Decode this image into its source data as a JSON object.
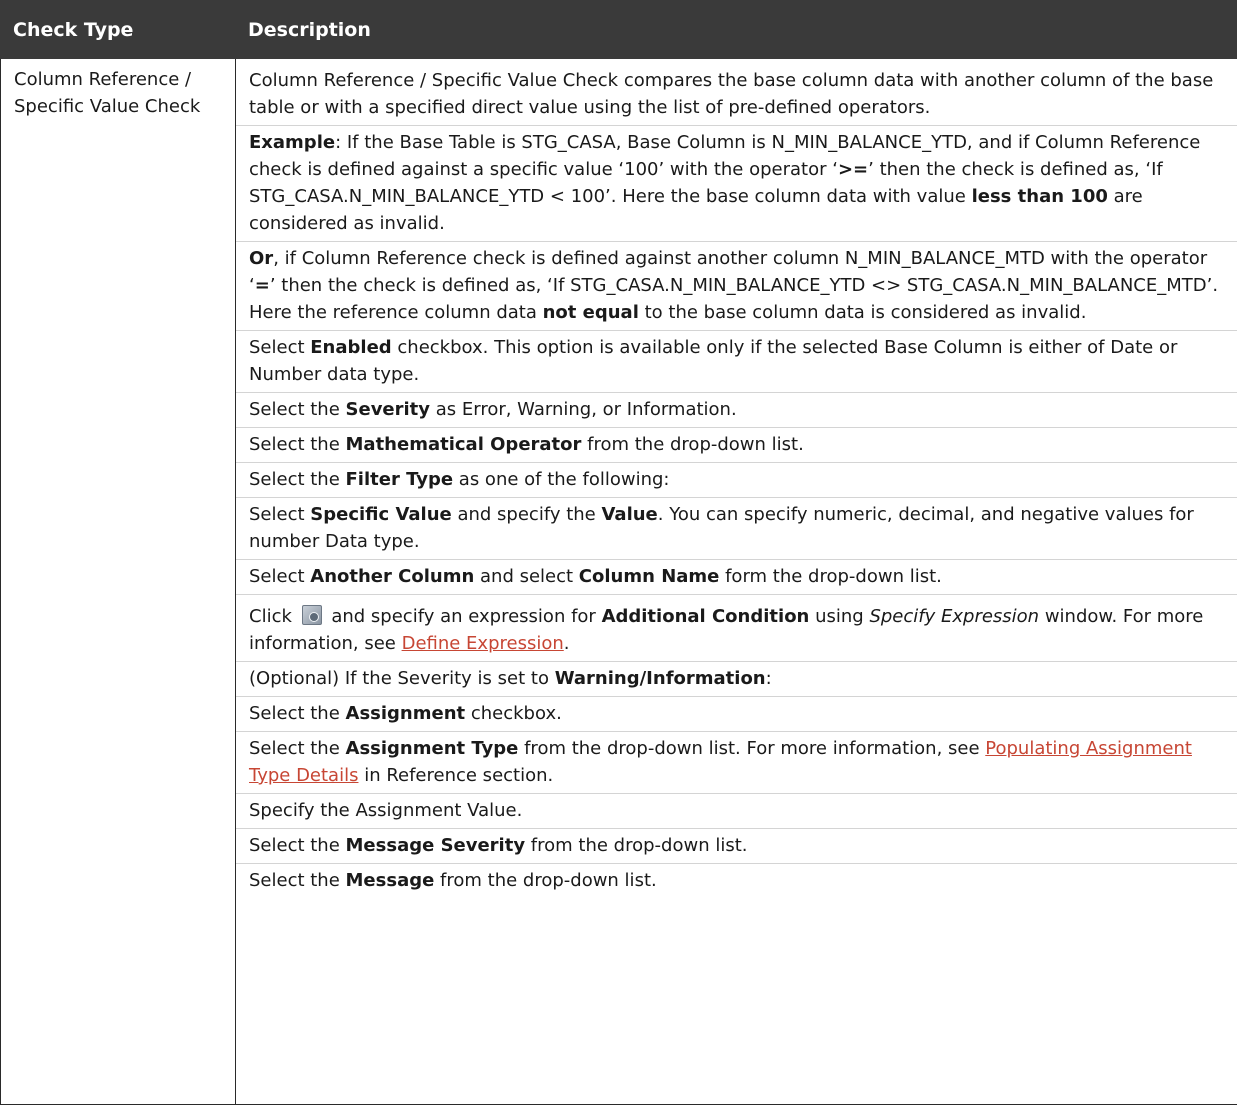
{
  "header": {
    "col1": "Check Type",
    "col2": "Description"
  },
  "row": {
    "check_type": "Column Reference / Specific Value Check",
    "p1": "Column Reference / Specific Value Check compares the base column data with another column of the base table or with a specified direct value using the list of pre-defined operators.",
    "p2": {
      "b1": "Example",
      "t1": ": If the Base Table is STG_CASA, Base Column is N_MIN_BALANCE_YTD, and if Column Reference check is defined against a specific value ‘100’ with the operator ‘",
      "b2": ">=",
      "t2": "’ then the check is defined as, ‘If STG_CASA.N_MIN_BALANCE_YTD < 100’. Here the base column data with value ",
      "b3": "less than 100",
      "t3": " are considered as invalid."
    },
    "p3": {
      "b1": "Or",
      "t1": ", if Column Reference check is defined against another column N_MIN_BALANCE_MTD with the operator ‘",
      "b2": "=",
      "t2": "’ then the check is defined as, ‘If STG_CASA.N_MIN_BALANCE_YTD <> STG_CASA.N_MIN_BALANCE_MTD’. Here the reference column data ",
      "b3": "not equal",
      "t3": " to the base column data is considered as invalid."
    },
    "p4": {
      "t0": "Select ",
      "b1": "Enabled",
      "t1": " checkbox. This option is available only if the selected Base Column is either of Date or Number data type."
    },
    "p5": {
      "t0": "Select the ",
      "b1": "Severity",
      "t1": " as Error, Warning, or Information."
    },
    "p6": {
      "t0": "Select the ",
      "b1": "Mathematical Operator",
      "t1": " from the drop-down list."
    },
    "p7": {
      "t0": "Select the ",
      "b1": "Filter Type",
      "t1": " as one of the following:"
    },
    "p8": {
      "t0": "Select ",
      "b1": "Specific Value",
      "t1": " and specify the ",
      "b2": "Value",
      "t2": ". You can specify numeric, decimal, and negative values for number Data type."
    },
    "p9": {
      "t0": "Select ",
      "b1": "Another Column",
      "t1": " and select ",
      "b2": "Column Name",
      "t2": " form the drop-down list."
    },
    "p10": {
      "t0": "Click ",
      "icon": "expression-icon",
      "t1": " and specify an expression for ",
      "b1": "Additional Condition",
      "t2": " using ",
      "i1": "Specify Expression",
      "t3": " window. For more information, see ",
      "link": "Define Expression",
      "t4": "."
    },
    "p11": {
      "t0": "(Optional) If the Severity is set to ",
      "b1": "Warning/Information",
      "t1": ":"
    },
    "p12": {
      "t0": "Select the ",
      "b1": "Assignment",
      "t1": " checkbox."
    },
    "p13": {
      "t0": "Select the ",
      "b1": "Assignment Type",
      "t1": " from the drop-down list. For more information, see ",
      "link": "Populating Assignment Type Details",
      "t2": " in Reference section."
    },
    "p14": "Specify the Assignment Value.",
    "p15": {
      "t0": "Select the ",
      "b1": "Message Severity",
      "t1": " from the drop-down list."
    },
    "p16": {
      "t0": "Select the ",
      "b1": "Message",
      "t1": " from the drop-down list."
    }
  },
  "colors": {
    "header_bg": "#3a3a3a",
    "link": "#c74634"
  }
}
